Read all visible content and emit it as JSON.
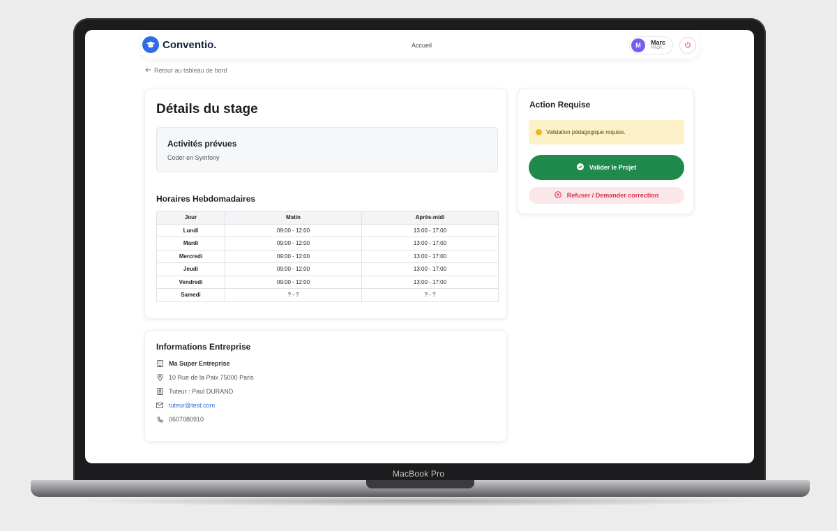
{
  "device": {
    "label": "MacBook Pro"
  },
  "header": {
    "brand": "Conventio.",
    "nav_home": "Accueil",
    "user": {
      "initial": "M",
      "name": "Marc",
      "role": "PROF."
    }
  },
  "back_link": "Retour au tableau de bord",
  "details": {
    "title": "Détails du stage",
    "activities_title": "Activités prévues",
    "activities_text": "Coder en Symfony",
    "schedule_title": "Horaires Hebdomadaires",
    "schedule": {
      "headers": [
        "Jour",
        "Matin",
        "Après-midi"
      ],
      "rows": [
        {
          "day": "Lundi",
          "morning": "09:00 - 12:00",
          "afternoon": "13:00 - 17:00"
        },
        {
          "day": "Mardi",
          "morning": "09:00 - 12:00",
          "afternoon": "13:00 - 17:00"
        },
        {
          "day": "Mercredi",
          "morning": "09:00 - 12:00",
          "afternoon": "13:00 - 17:00"
        },
        {
          "day": "Jeudi",
          "morning": "09:00 - 12:00",
          "afternoon": "13:00 - 17:00"
        },
        {
          "day": "Vendredi",
          "morning": "09:00 - 12:00",
          "afternoon": "13:00 - 17:00"
        },
        {
          "day": "Samedi",
          "morning": "? - ?",
          "afternoon": "? - ?"
        }
      ]
    }
  },
  "company": {
    "title": "Informations Entreprise",
    "name": "Ma Super Entreprise",
    "address": "10 Rue de la Paix 75000 Paris",
    "tutor": "Tuteur : Paul DURAND",
    "email": "tuteur@test.com",
    "phone": "0607080910"
  },
  "action": {
    "title": "Action Requise",
    "alert": "Validation pédagogique requise.",
    "validate_label": "Valider le Projet",
    "refuse_label": "Refuser / Demander correction"
  },
  "colors": {
    "brand_blue": "#2f6ce5",
    "avatar_purple": "#7c5cf0",
    "validate_green": "#1f8a4c",
    "refuse_red": "#d6334a",
    "alert_yellow": "#fdf1c7"
  }
}
